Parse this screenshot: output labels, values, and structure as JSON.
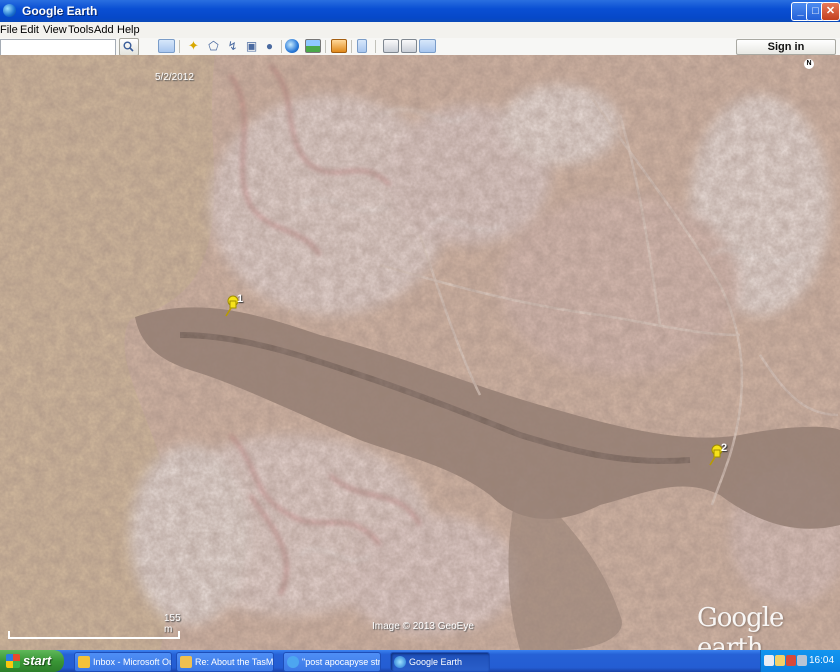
{
  "window": {
    "title": "Google Earth",
    "buttons": {
      "minimize": "_",
      "maximize": "□",
      "close": "✕"
    }
  },
  "menu": {
    "items": [
      "File",
      "Edit",
      "View",
      "Tools",
      "Add",
      "Help"
    ]
  },
  "toolbar": {
    "search_value": "",
    "signin_label": "Sign in",
    "icons": [
      "hide-sidebar-icon",
      "add-placemark-icon",
      "add-polygon-icon",
      "add-path-icon",
      "add-image-overlay-icon",
      "record-tour-icon",
      "historical-imagery-icon",
      "sunlight-icon",
      "planets-icon",
      "ruler-icon",
      "email-icon",
      "print-icon",
      "save-image-icon"
    ]
  },
  "map": {
    "date_label": "5/2/2012",
    "north_label": "N",
    "placemarks": [
      {
        "label": "1"
      },
      {
        "label": "2"
      }
    ],
    "scale_label": "155 m",
    "imagery_credit": "Image © 2013 GeoEye",
    "logo_text": "Google earth"
  },
  "taskbar": {
    "start_label": "start",
    "tasks": [
      {
        "label": "Inbox - Microsoft Out...",
        "icon": "outlook-icon",
        "active": false
      },
      {
        "label": "Re: About the TasMa...",
        "icon": "email-icon",
        "active": false
      },
      {
        "label": "\"post apocapyse stra...",
        "icon": "browser-icon",
        "active": false
      },
      {
        "label": "Google Earth",
        "icon": "google-earth-icon",
        "active": true
      }
    ],
    "clock": "16:04"
  }
}
